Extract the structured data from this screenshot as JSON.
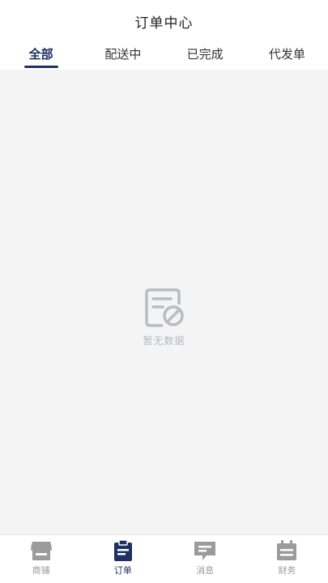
{
  "header": {
    "title": "订单中心"
  },
  "tabs": [
    {
      "label": "全部",
      "active": true
    },
    {
      "label": "配送中",
      "active": false
    },
    {
      "label": "已完成",
      "active": false
    },
    {
      "label": "代发单",
      "active": false
    }
  ],
  "empty_state": {
    "icon": "no-data-document-icon",
    "text": "暂无数据"
  },
  "tabbar": [
    {
      "label": "商铺",
      "icon": "shop-icon",
      "active": false
    },
    {
      "label": "订单",
      "icon": "order-clipboard-icon",
      "active": true
    },
    {
      "label": "消息",
      "icon": "message-bubble-icon",
      "active": false
    },
    {
      "label": "财务",
      "icon": "finance-calendar-icon",
      "active": false
    }
  ],
  "colors": {
    "accent": "#1f3161",
    "inactive_icon": "#999999",
    "background": "#f4f4f4"
  }
}
